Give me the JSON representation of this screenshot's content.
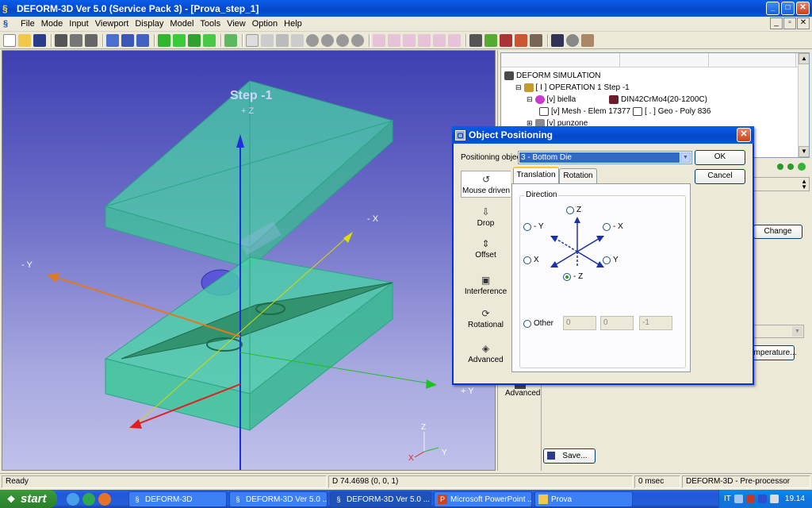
{
  "window": {
    "title": "DEFORM-3D  Ver 5.0 (Service Pack 3)   - [Prova_step_1]",
    "min": "_",
    "max": "□",
    "close": "✕"
  },
  "menu": [
    "File",
    "Mode",
    "Input",
    "Viewport",
    "Display",
    "Model",
    "Tools",
    "View",
    "Option",
    "Help"
  ],
  "viewport": {
    "step_label": "Step   -1",
    "axis_labels": {
      "pz": "+ Z",
      "mx": "- X",
      "my": "- Y",
      "py": "+ Y"
    },
    "triad": {
      "z": "Z",
      "x": "X",
      "y": "Y"
    }
  },
  "tree": {
    "root": "DEFORM SIMULATION",
    "operation": "[ I ]  OPERATION 1  Step -1",
    "obj1": "[v] biella",
    "material": "DIN42CrMo4(20-1200C)",
    "mesh": "[v] Mesh - Elem 17377",
    "geo": "[ . ] Geo - Poly 836",
    "obj2": "[v] punzone"
  },
  "right_panel": {
    "change_button": "Change",
    "temperature_button": "emperature...",
    "advanced_label": "Advanced",
    "save_button": "Save..."
  },
  "dialog": {
    "title": "Object Positioning",
    "positioning_label": "Positioning object",
    "positioning_value": "3    - Bottom Die",
    "ok": "OK",
    "cancel": "Cancel",
    "modes": [
      "Mouse driven",
      "Drop",
      "Offset",
      "Interference",
      "Rotational",
      "Advanced"
    ],
    "tabs": [
      "Translation",
      "Rotation"
    ],
    "direction_label": "Direction",
    "directions": {
      "z": "Z",
      "my": "- Y",
      "mx": "- X",
      "x": "X",
      "y": "Y",
      "mz": "- Z"
    },
    "other_label": "Other",
    "other_values": [
      "0",
      "0",
      "-1"
    ]
  },
  "status": {
    "ready": "Ready",
    "coords": "D 74.4698 (0, 0, 1)",
    "time": "0 msec",
    "module": "DEFORM-3D  -  Pre-processor"
  },
  "taskbar": {
    "start": "start",
    "tasks": [
      "DEFORM-3D",
      "DEFORM-3D  Ver 5.0 ...",
      "DEFORM-3D  Ver 5.0 ...",
      "Microsoft PowerPoint ...",
      "Prova"
    ],
    "lang": "IT",
    "clock": "19.14"
  },
  "colors": {
    "die_fill": "#49d1a6",
    "viewport_top": "#3e3fb2",
    "xp_blue": "#0a5de8",
    "start_green": "#3c9c3c"
  }
}
